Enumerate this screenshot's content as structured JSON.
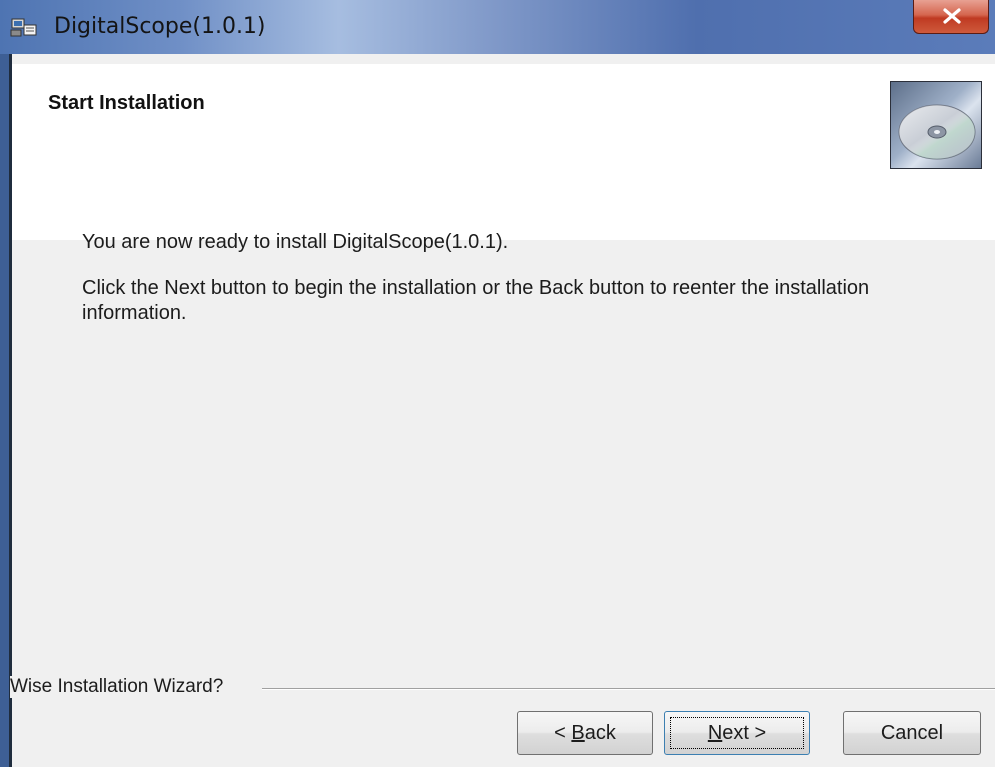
{
  "window": {
    "title": "DigitalScope(1.0.1)"
  },
  "header": {
    "title": "Start Installation",
    "icon": "cd-disc-icon"
  },
  "content": {
    "ready_text": "You are now ready to install DigitalScope(1.0.1).",
    "instructions": "Click the Next button to begin the installation or the Back button to reenter the installation information."
  },
  "footer": {
    "wizard_label": "Wise Installation Wizard?"
  },
  "buttons": {
    "back_prefix": "< ",
    "back_mnemonic": "B",
    "back_rest": "ack",
    "next_mnemonic": "N",
    "next_rest": "ext >",
    "cancel": "Cancel"
  },
  "colors": {
    "title_bar": "#6f8fc6",
    "close_button": "#c8452c",
    "dialog_background": "#f0f0f0",
    "header_background": "#ffffff",
    "focus_border": "#3c7fb1"
  }
}
